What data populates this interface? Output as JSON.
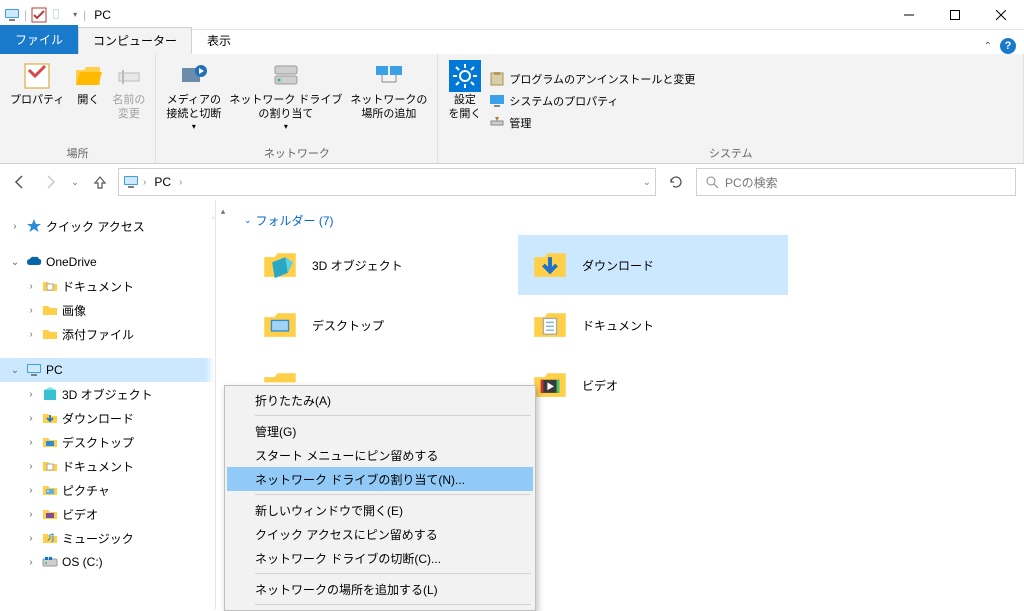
{
  "window": {
    "title": "PC",
    "tabs": {
      "file": "ファイル",
      "computer": "コンピューター",
      "view": "表示"
    }
  },
  "ribbon": {
    "groups": {
      "location": {
        "label": "場所",
        "properties": "プロパティ",
        "open": "開く",
        "rename": "名前の\n変更"
      },
      "network": {
        "label": "ネットワーク",
        "media": "メディアの\n接続と切断",
        "map_drive": "ネットワーク ドライブ\nの割り当て",
        "add_location": "ネットワークの\n場所の追加"
      },
      "system": {
        "label": "システム",
        "open_settings": "設定\nを開く",
        "uninstall": "プログラムのアンインストールと変更",
        "sys_props": "システムのプロパティ",
        "manage": "管理"
      }
    }
  },
  "nav": {
    "breadcrumb": "PC",
    "search_placeholder": "PCの検索"
  },
  "sidebar": {
    "quick_access": "クイック アクセス",
    "onedrive": "OneDrive",
    "onedrive_children": [
      "ドキュメント",
      "画像",
      "添付ファイル"
    ],
    "pc": "PC",
    "pc_children": [
      "3D オブジェクト",
      "ダウンロード",
      "デスクトップ",
      "ドキュメント",
      "ピクチャ",
      "ビデオ",
      "ミュージック",
      "OS (C:)"
    ]
  },
  "content": {
    "group_label": "フォルダー (7)",
    "folders": [
      "3D オブジェクト",
      "ダウンロード",
      "デスクトップ",
      "ドキュメント",
      "ビデオ"
    ],
    "selected": "ダウンロード"
  },
  "context_menu": {
    "items": [
      {
        "label": "折りたたみ(A)",
        "sep_after": true
      },
      {
        "label": "管理(G)"
      },
      {
        "label": "スタート メニューにピン留めする"
      },
      {
        "label": "ネットワーク ドライブの割り当て(N)...",
        "hover": true,
        "sep_after": true
      },
      {
        "label": "新しいウィンドウで開く(E)"
      },
      {
        "label": "クイック アクセスにピン留めする"
      },
      {
        "label": "ネットワーク ドライブの切断(C)...",
        "sep_after": true
      },
      {
        "label": "ネットワークの場所を追加する(L)",
        "sep_after": true
      }
    ]
  }
}
